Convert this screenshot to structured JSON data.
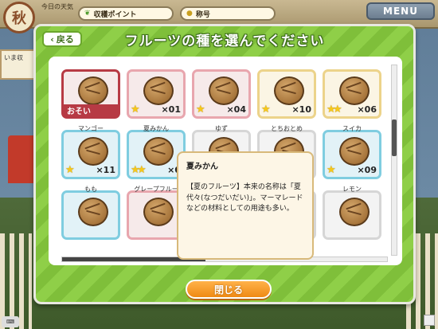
{
  "hud": {
    "season": "秋",
    "weather_label": "今日の天気",
    "harvest_label": "収穫ポイント",
    "title_label": "称号",
    "menu_label": "MENU",
    "side_now": "いま収"
  },
  "dialog": {
    "title": "フルーツの種を選んでください",
    "back_label": "戻る",
    "close_label": "閉じる"
  },
  "seeds": [
    {
      "name": "",
      "count": "",
      "slow": "おそい",
      "stars": 0,
      "style": "red"
    },
    {
      "name": "",
      "count": "×01",
      "slow": "",
      "stars": 1,
      "style": "pink"
    },
    {
      "name": "",
      "count": "×04",
      "slow": "",
      "stars": 1,
      "style": "pink"
    },
    {
      "name": "",
      "count": "×10",
      "slow": "",
      "stars": 1,
      "style": "yellow"
    },
    {
      "name": "",
      "count": "×06",
      "slow": "",
      "stars": 2,
      "style": "yellow"
    },
    {
      "name": "マンゴー",
      "count": "×11",
      "slow": "",
      "stars": 1,
      "style": "blue"
    },
    {
      "name": "夏みかん",
      "count": "×0",
      "slow": "",
      "stars": 2,
      "style": "blue"
    },
    {
      "name": "ゆず",
      "count": "",
      "slow": "",
      "stars": 0,
      "style": "gray"
    },
    {
      "name": "とちおとめ",
      "count": "",
      "slow": "",
      "stars": 0,
      "style": "gray"
    },
    {
      "name": "スイカ",
      "count": "×09",
      "slow": "",
      "stars": 1,
      "style": "blue"
    },
    {
      "name": "もも",
      "count": "",
      "slow": "",
      "stars": 0,
      "style": "blue"
    },
    {
      "name": "グレープフルー",
      "count": "",
      "slow": "",
      "stars": 0,
      "style": "pink"
    },
    {
      "name": "",
      "count": "",
      "slow": "",
      "stars": 0,
      "style": "gray"
    },
    {
      "name": "",
      "count": "",
      "slow": "",
      "stars": 0,
      "style": "gray"
    },
    {
      "name": "レモン",
      "count": "",
      "slow": "",
      "stars": 0,
      "style": "gray"
    }
  ],
  "tooltip": {
    "title": "夏みかん",
    "description": "【夏のフルーツ】本来の名称は「夏代々(なつだいだい)」。マーマレードなどの材料としての用途も多い。"
  },
  "colors": {
    "dialog_green": "#7fbf3a",
    "close_orange": "#ef8a14"
  }
}
